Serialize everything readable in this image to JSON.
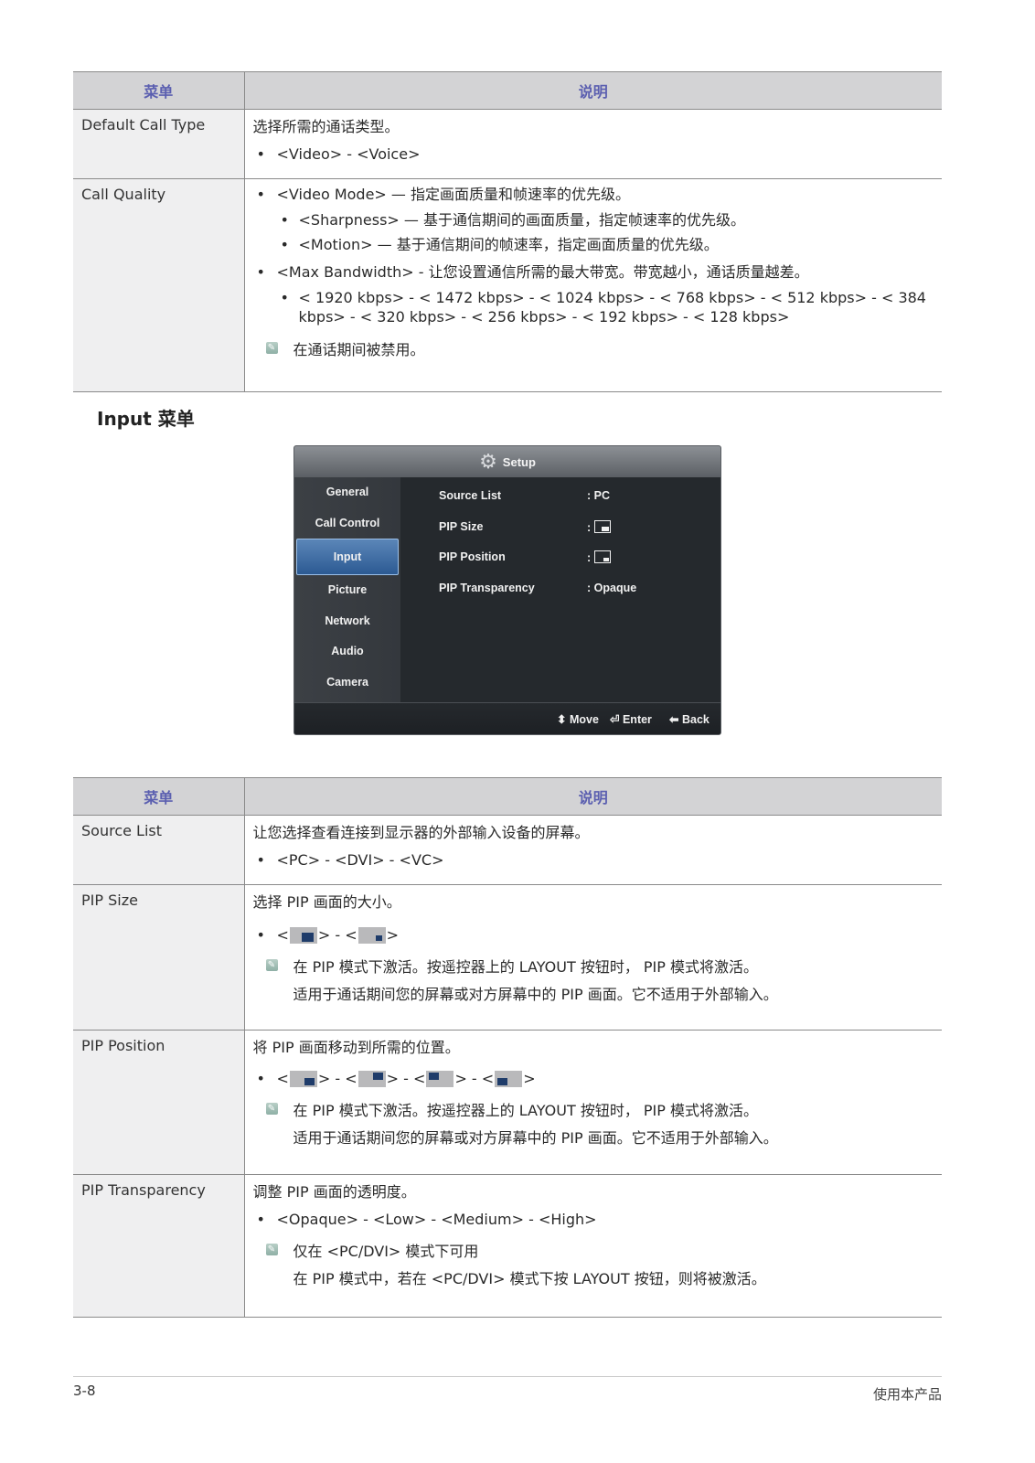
{
  "table1": {
    "header": {
      "col1": "菜单",
      "col2": "说明"
    },
    "rows": [
      {
        "name": "Default Call Type",
        "desc": "选择所需的通话类型。",
        "bullet": "<Video> - <Voice>"
      },
      {
        "name": "Call Quality",
        "b1": "<Video Mode> — 指定画面质量和帧速率的优先级。",
        "b1_sub1": "<Sharpness> — 基于通信期间的画面质量，指定帧速率的优先级。",
        "b1_sub2": "<Motion> — 基于通信期间的帧速率，指定画面质量的优先级。",
        "b2": "<Max Bandwidth> - 让您设置通信所需的最大带宽。带宽越小，通话质量越差。",
        "b2_sub1": "< 1920 kbps> - < 1472 kbps> - < 1024 kbps> - < 768 kbps> - < 512 kbps> - < 384 kbps> - < 320 kbps> - < 256 kbps> - < 192 kbps> - < 128 kbps>",
        "note": "在通话期间被禁用。"
      }
    ]
  },
  "section_title": "Input 菜单",
  "osd": {
    "title": "Setup",
    "menu": [
      "General",
      "Call Control",
      "Input",
      "Picture",
      "Network",
      "Audio",
      "Camera"
    ],
    "selected": "Input",
    "rows": [
      {
        "label": "Source List",
        "value": ": PC"
      },
      {
        "label": "PIP Size",
        "value": ":"
      },
      {
        "label": "PIP Position",
        "value": ":"
      },
      {
        "label": "PIP Transparency",
        "value": ": Opaque"
      }
    ],
    "footer": {
      "move": "Move",
      "enter": "Enter",
      "back": "Back"
    }
  },
  "table2": {
    "header": {
      "col1": "菜单",
      "col2": "说明"
    },
    "rows": [
      {
        "name": "Source List",
        "desc": "让您选择查看连接到显示器的外部输入设备的屏幕。",
        "bullet": "<PC> - <DVI> - <VC>"
      },
      {
        "name": "PIP Size",
        "desc": "选择 PIP 画面的大小。",
        "note1": "在 PIP 模式下激活。按遥控器上的 LAYOUT 按钮时， PIP 模式将激活。",
        "note2": "适用于通话期间您的屏幕或对方屏幕中的 PIP 画面。它不适用于外部输入。"
      },
      {
        "name": "PIP Position",
        "desc": "将 PIP 画面移动到所需的位置。",
        "note1": "在 PIP 模式下激活。按遥控器上的 LAYOUT 按钮时， PIP 模式将激活。",
        "note2": "适用于通话期间您的屏幕或对方屏幕中的 PIP 画面。它不适用于外部输入。"
      },
      {
        "name": "PIP Transparency",
        "desc": "调整 PIP 画面的透明度。",
        "bullet": "<Opaque> - <Low> - <Medium> - <High>",
        "note1": "仅在 <PC/DVI> 模式下可用",
        "note2": "在 PIP 模式中，若在 <PC/DVI> 模式下按 LAYOUT 按钮，则将被激活。"
      }
    ]
  },
  "footer": {
    "page": "3-8",
    "chapter": "使用本产品"
  }
}
